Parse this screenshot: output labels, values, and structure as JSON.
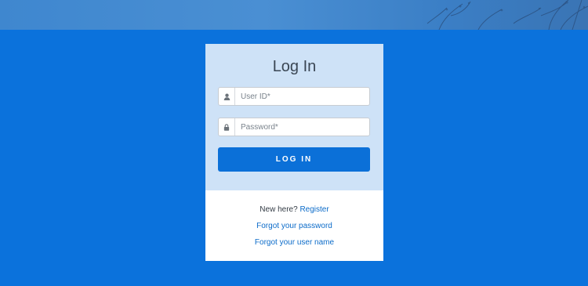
{
  "login": {
    "title": "Log In",
    "user_id_placeholder": "User ID*",
    "password_placeholder": "Password*",
    "login_button_label": "LOG IN"
  },
  "footer_links": {
    "new_here_text": "New here?",
    "register_label": "Register",
    "forgot_password_label": "Forgot your password",
    "forgot_username_label": "Forgot your user name"
  },
  "icons": {
    "user": "user-icon",
    "lock": "lock-icon"
  },
  "colors": {
    "background": "#0b72dc",
    "card_top": "#cee2f7",
    "button": "#0b70d8",
    "link": "#0b6bc9"
  }
}
